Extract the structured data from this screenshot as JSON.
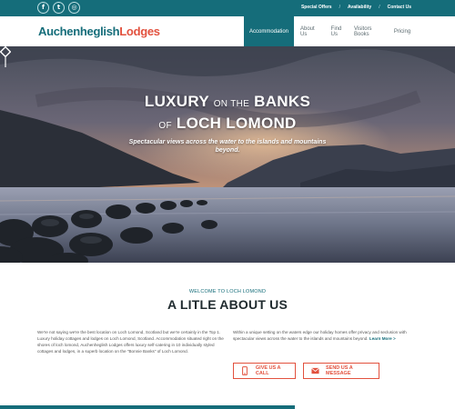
{
  "colors": {
    "brand_teal": "#156d7a",
    "brand_red": "#e2513e",
    "text_dark": "#1f2a2e"
  },
  "social": [
    {
      "icon": "facebook-icon",
      "glyph": "f"
    },
    {
      "icon": "twitter-icon",
      "glyph": "t"
    },
    {
      "icon": "instagram-icon",
      "glyph": "◎"
    }
  ],
  "top_links": [
    "Special Offers",
    "Availability",
    "Contact Us"
  ],
  "logo": {
    "part1": "Auchenheglish",
    "part2": "Lodges"
  },
  "nav": [
    "Accommodation",
    "About Us",
    "Find Us",
    "Visitors Books",
    "Pricing"
  ],
  "hero": {
    "line1_a": "LUXURY",
    "line1_b": "ON THE",
    "line1_c": "BANKS",
    "line2_a": "OF",
    "line2_b": "LOCH LOMOND",
    "subtitle": "Spectacular views across the water to the islands and mountains beyond."
  },
  "about": {
    "welcome": "WELCOME TO LOCH LOMOND",
    "title": "A LITLE ABOUT US",
    "left_text": "We're not saying we're the best location on Loch Lomond, Scotland but we're certainly in the Top 1. Luxury holiday cottages and lodges on Loch Lomond, Scotland. Accommodation situated right on the shores of loch lomond, Auchenheglish Lodges offers luxury self-catering in 10 individually styled cottages and lodges, in a superb location on the \"Bonnie Banks\" of Loch Lomond.",
    "right_text": "Within a unique setting on the waters edge our holiday homes offer privacy and seclusion with spectacular views across the water to the islands and mountains beyond.",
    "learn_more": "Learn More >",
    "call_button": "GIVE US A CALL",
    "message_button": "SEND US A MESSAGE"
  }
}
